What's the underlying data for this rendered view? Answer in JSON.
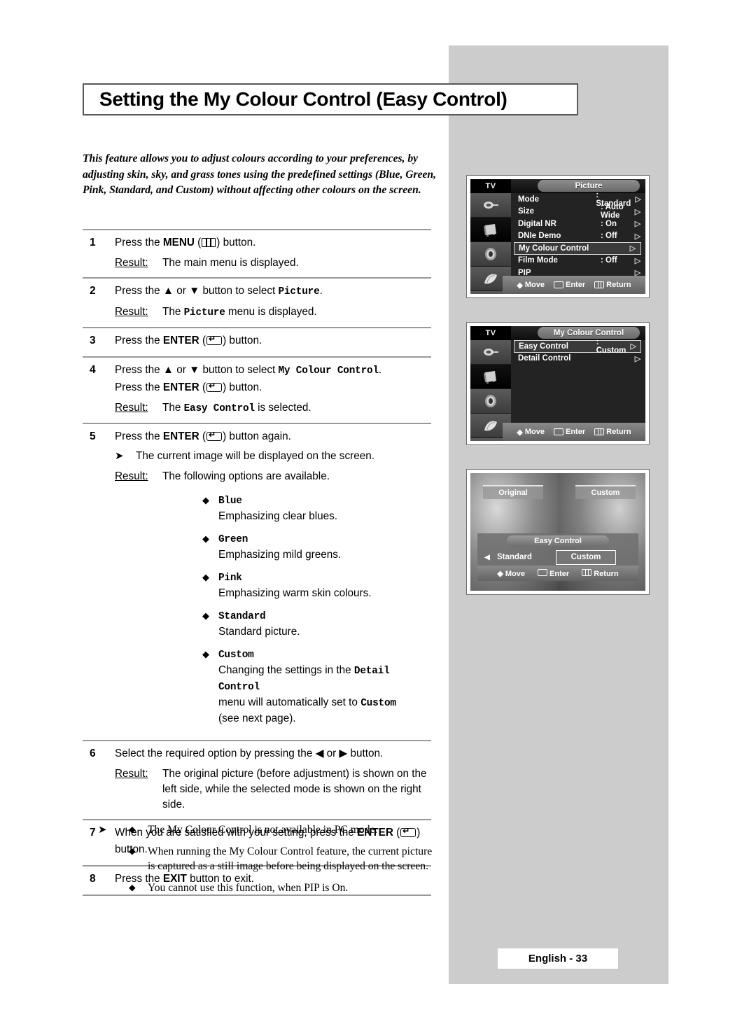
{
  "page": {
    "title": "Setting the My Colour Control (Easy Control)",
    "intro": "This feature allows you to adjust colours according to your preferences, by adjusting skin, sky, and grass tones using the predefined settings (Blue, Green, Pink, Standard, and Custom) without affecting other colours on the screen.",
    "footer": "English - 33",
    "result_label": "Result:",
    "arrow_glyph": "➤",
    "diamond_glyph": "◆"
  },
  "steps": [
    {
      "num": "1",
      "line_pre": "Press the ",
      "key_bold": "MENU",
      "key_icon": "menu-key-icon",
      "line_post": " button.",
      "result": "The main menu is displayed."
    },
    {
      "num": "2",
      "line_pre": "Press the ▲ or ▼ button to select ",
      "mono": "Picture",
      "line_post": ".",
      "result_pre": "The ",
      "result_mono": "Picture",
      "result_post": " menu is displayed."
    },
    {
      "num": "3",
      "line_pre": "Press the ",
      "key_bold": "ENTER",
      "key_icon": "enter-key-icon",
      "line_post": " button."
    },
    {
      "num": "4",
      "line_pre": "Press the ▲ or ▼ button to select ",
      "mono": "My Colour Control",
      "line_post": ".",
      "line2_pre": "Press the ",
      "key_bold": "ENTER",
      "key_icon": "enter-key-icon",
      "line2_post": " button.",
      "result_pre": "The ",
      "result_mono": "Easy Control",
      "result_post": " is selected."
    },
    {
      "num": "5",
      "line_pre": "Press the ",
      "key_bold": "ENTER",
      "key_icon": "enter-key-icon",
      "line_post": " button again.",
      "note": "The current image will be displayed on the screen.",
      "result": "The following options are available.",
      "options": [
        {
          "name": "Blue",
          "desc": "Emphasizing clear blues."
        },
        {
          "name": "Green",
          "desc": "Emphasizing mild greens."
        },
        {
          "name": "Pink",
          "desc": "Emphasizing warm skin colours."
        },
        {
          "name": "Standard",
          "desc": "Standard picture."
        },
        {
          "name": "Custom",
          "desc_part1": "Changing the settings in the ",
          "desc_mono1": "Detail Control",
          "desc_part2": "menu will automatically set to ",
          "desc_mono2": "Custom",
          "desc_part3": "(see next page)."
        }
      ]
    },
    {
      "num": "6",
      "line_pre": "Select the required option by pressing the ◀ or ▶ button.",
      "result": "The original picture (before adjustment) is shown on the left side, while the selected mode is shown on the right side."
    },
    {
      "num": "7",
      "line_pre": "When you are satisfied with your setting, press the ",
      "key_bold": "ENTER",
      "key_icon": "enter-key-icon",
      "line_post": "",
      "line2_post": "button."
    },
    {
      "num": "8",
      "line_pre": "Press the ",
      "key_bold": "EXIT",
      "line_post": " button to exit."
    }
  ],
  "notes": [
    "The My Colour Control is not available in PC mode.",
    "When running the My Colour Control feature, the current picture is captured as a still image before being displayed on the screen.",
    "You cannot use this function, when PIP is On."
  ],
  "osd": {
    "picture_menu": {
      "source_label": "TV",
      "title": "Picture",
      "rows": [
        {
          "label": "Mode",
          "value": ": Standard",
          "chevron": "▷",
          "highlighted": false
        },
        {
          "label": "Size",
          "value": ": Auto Wide",
          "chevron": "▷",
          "highlighted": false
        },
        {
          "label": "Digital NR",
          "value": ": On",
          "chevron": "▷",
          "highlighted": false
        },
        {
          "label": "DNIe Demo",
          "value": ": Off",
          "chevron": "▷",
          "highlighted": false
        },
        {
          "label": "My Colour Control",
          "value": "",
          "chevron": "▷",
          "highlighted": true
        },
        {
          "label": "Film Mode",
          "value": ": Off",
          "chevron": "▷",
          "highlighted": false
        },
        {
          "label": "PIP",
          "value": "",
          "chevron": "▷",
          "highlighted": false
        }
      ],
      "bottom": {
        "move": "Move",
        "enter": "Enter",
        "return": "Return"
      }
    },
    "mycolour_menu": {
      "source_label": "TV",
      "title": "My Colour Control",
      "rows": [
        {
          "label": "Easy Control",
          "value": ": Custom",
          "chevron": "▷",
          "highlighted": true
        },
        {
          "label": "Detail Control",
          "value": "",
          "chevron": "▷",
          "highlighted": false
        }
      ],
      "bottom": {
        "move": "Move",
        "enter": "Enter",
        "return": "Return"
      }
    },
    "preview": {
      "left_tag": "Original",
      "right_tag": "Custom",
      "popup_title": "Easy Control",
      "left_arrow": "◀",
      "prev_option": "Standard",
      "current_option": "Custom",
      "bottom": {
        "move": "Move",
        "enter": "Enter",
        "return": "Return"
      }
    }
  },
  "colors": {
    "grey_panel": "#cccccc",
    "rule": "#9a9a9a",
    "title_border": "#58595b"
  }
}
